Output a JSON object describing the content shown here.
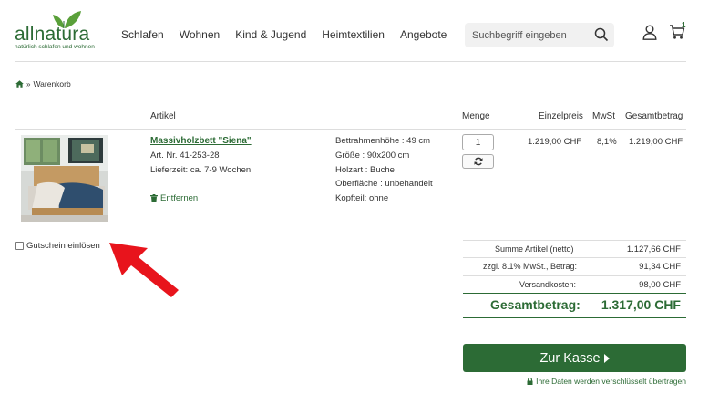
{
  "header": {
    "logo_text": "allnatura",
    "logo_tagline": "natürlich schlafen und wohnen",
    "nav": [
      "Schlafen",
      "Wohnen",
      "Kind & Jugend",
      "Heimtextilien",
      "Angebote"
    ],
    "search_placeholder": "Suchbegriff eingeben",
    "cart_count": "1",
    "icons": [
      "search-icon",
      "user-icon",
      "cart-icon"
    ]
  },
  "breadcrumb": {
    "home_icon": "home-icon",
    "current": "Warenkorb"
  },
  "table": {
    "headers": {
      "artikel": "Artikel",
      "menge": "Menge",
      "einzelpreis": "Einzelpreis",
      "mwst": "MwSt",
      "gesamtbetrag": "Gesamtbetrag"
    }
  },
  "product": {
    "name": "Massivholzbett \"Siena\"",
    "artnr": "Art. Nr. 41-253-28",
    "delivery": "Lieferzeit: ca. 7-9 Wochen",
    "remove_label": "Entfernen",
    "attributes": [
      "Bettrahmenhöhe : 49 cm",
      "Größe : 90x200 cm",
      "Holzart : Buche",
      "Oberfläche : unbehandelt",
      "Kopfteil: ohne"
    ],
    "quantity": "1",
    "unit_price": "1.219,00 CHF",
    "vat": "8,1%",
    "total": "1.219,00 CHF"
  },
  "voucher": {
    "label": "Gutschein einlösen",
    "checked": false
  },
  "totals": {
    "net_label": "Summe Artikel (netto)",
    "net_value": "1.127,66 CHF",
    "vat_label": "zzgl. 8.1% MwSt., Betrag:",
    "vat_value": "91,34 CHF",
    "shipping_label": "Versandkosten:",
    "shipping_value": "98,00 CHF",
    "grand_label": "Gesamtbetrag:",
    "grand_value": "1.317,00 CHF"
  },
  "checkout": {
    "button_label": "Zur Kasse",
    "secure_note": "Ihre Daten werden verschlüsselt übertragen"
  },
  "colors": {
    "brand_green": "#2c6b35",
    "annotation_red": "#e8141c"
  }
}
